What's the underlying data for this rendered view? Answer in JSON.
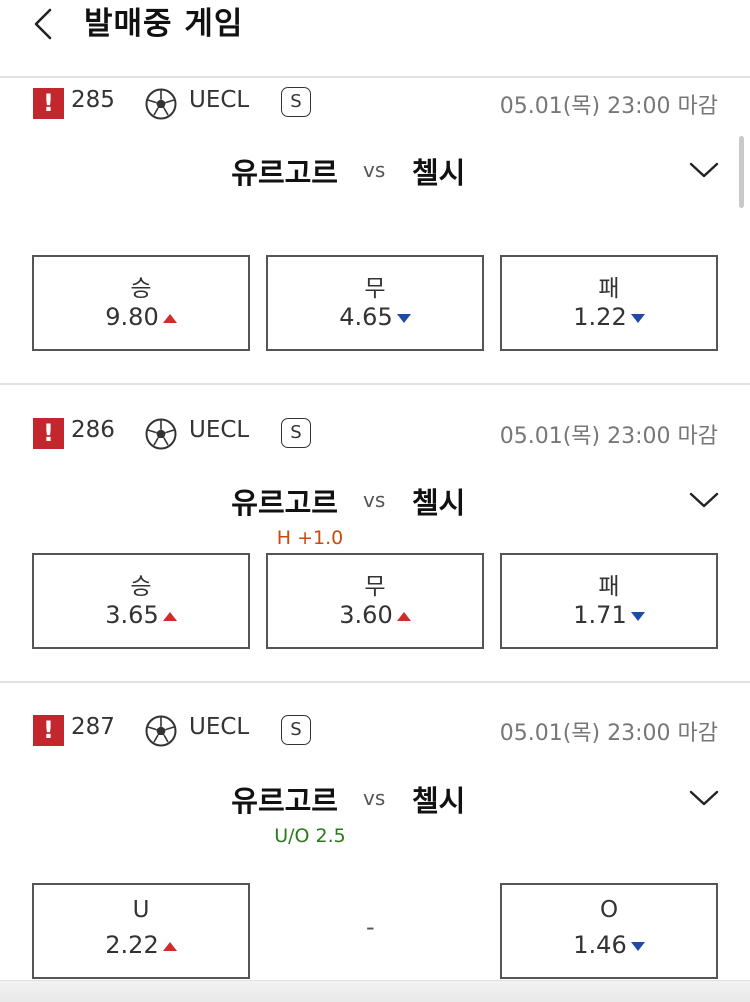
{
  "header": {
    "title": "발매중 게임"
  },
  "games": [
    {
      "number": "285",
      "league": "UECL",
      "badge": "S",
      "deadline": "05.01(목) 23:00 마감",
      "home": "유르고르",
      "vs": "vs",
      "away": "첼시",
      "handicap": "",
      "odds": [
        {
          "label": "승",
          "value": "9.80",
          "trend": "up"
        },
        {
          "label": "무",
          "value": "4.65",
          "trend": "down"
        },
        {
          "label": "패",
          "value": "1.22",
          "trend": "down"
        }
      ]
    },
    {
      "number": "286",
      "league": "UECL",
      "badge": "S",
      "deadline": "05.01(목) 23:00 마감",
      "home": "유르고르",
      "vs": "vs",
      "away": "첼시",
      "handicap": "H +1.0",
      "odds": [
        {
          "label": "승",
          "value": "3.65",
          "trend": "up"
        },
        {
          "label": "무",
          "value": "3.60",
          "trend": "up"
        },
        {
          "label": "패",
          "value": "1.71",
          "trend": "down"
        }
      ]
    },
    {
      "number": "287",
      "league": "UECL",
      "badge": "S",
      "deadline": "05.01(목) 23:00 마감",
      "home": "유르고르",
      "vs": "vs",
      "away": "첼시",
      "handicap": "U/O 2.5",
      "odds": [
        {
          "label": "U",
          "value": "2.22",
          "trend": "up"
        },
        {
          "label": "",
          "value": "-",
          "trend": ""
        },
        {
          "label": "O",
          "value": "1.46",
          "trend": "down"
        }
      ]
    }
  ],
  "icons": {
    "back": "chevron-left-icon",
    "alert": "exclamation-icon",
    "sport": "soccer-ball-icon",
    "expand": "chevron-down-icon"
  },
  "colors": {
    "alert": "#c1272d",
    "up": "#d32a2a",
    "down": "#1f4aa8",
    "handicap_h": "#c9490f",
    "handicap_uo": "#2a7a1c"
  }
}
